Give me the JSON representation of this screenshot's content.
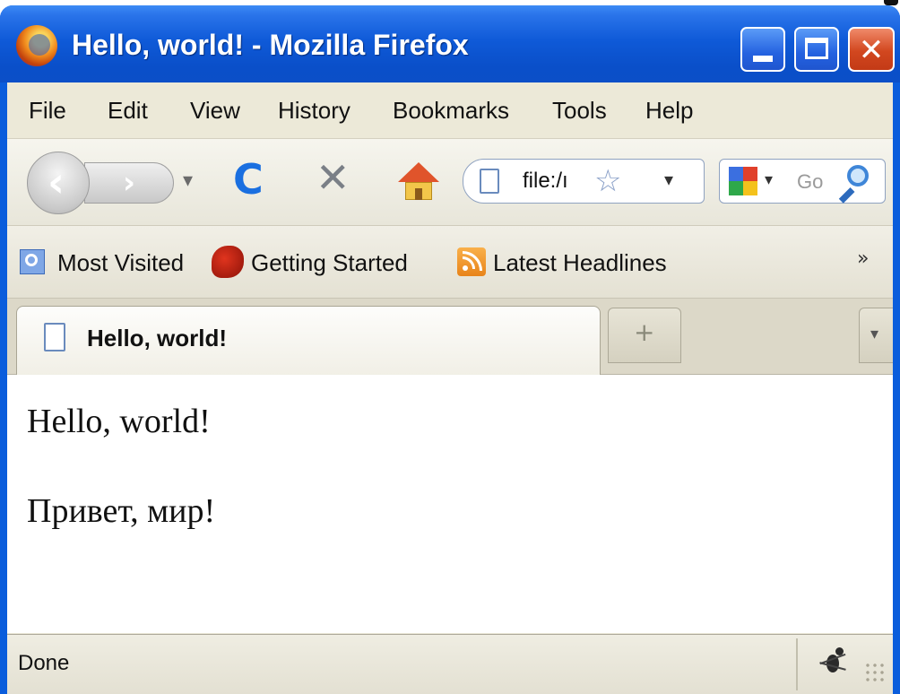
{
  "window": {
    "title": "Hello, world! - Mozilla Firefox",
    "minimize_glyph": "_",
    "maximize_glyph": "□",
    "close_glyph": "✕"
  },
  "menu": {
    "file": "File",
    "edit": "Edit",
    "view": "View",
    "history": "History",
    "bookmarks": "Bookmarks",
    "tools": "Tools",
    "help": "Help"
  },
  "navigation": {
    "back_glyph": "‹",
    "forward_glyph": "›",
    "history_dropdown_glyph": "▾",
    "reload_glyph": "C",
    "stop_glyph": "✕",
    "home_icon": "home-icon",
    "url_value": "file:///",
    "url_display": "file:/ı",
    "star_glyph": "☆",
    "url_dropdown_glyph": "▾",
    "search_engine_icon": "google-icon",
    "search_engine_dropdown_glyph": "▾",
    "search_placeholder": "Go",
    "search_button_icon": "magnifier-icon"
  },
  "bookmarks_toolbar": {
    "items": [
      {
        "label": "Most Visited",
        "icon": "most-visited-icon"
      },
      {
        "label": "Getting Started",
        "icon": "firefox-getting-started-icon"
      },
      {
        "label": "Latest Headlines",
        "icon": "rss-feed-icon"
      }
    ],
    "overflow_glyph": "»"
  },
  "tabs": {
    "items": [
      {
        "label": "Hello, world!",
        "icon": "page-icon",
        "active": true
      }
    ],
    "new_tab_glyph": "+",
    "list_all_glyph": "▾"
  },
  "page_content": {
    "line1": "Hello, world!",
    "line2": "Привет, мир!"
  },
  "status": {
    "text": "Done"
  },
  "colors": {
    "titlebar_blue": "#0a4fc9",
    "chrome_beige": "#ece9d8",
    "close_red": "#d2471f",
    "reload_blue": "#1a6fe0",
    "stop_gray": "#7a7f86"
  }
}
